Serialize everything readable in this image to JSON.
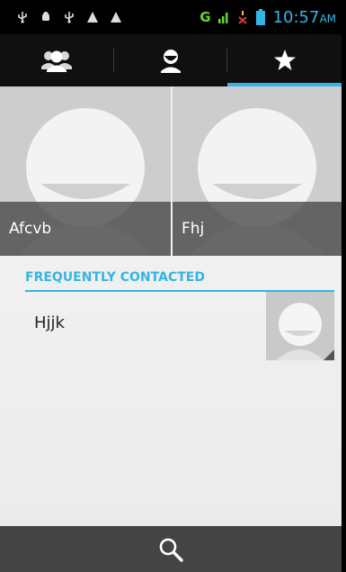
{
  "status_bar": {
    "network": "G",
    "time": "10:57",
    "ampm": "AM"
  },
  "tabs": [
    {
      "icon": "groups-icon",
      "selected": false
    },
    {
      "icon": "contact-icon",
      "selected": false
    },
    {
      "icon": "star-icon",
      "selected": true
    }
  ],
  "favorites": [
    {
      "name": "Afcvb"
    },
    {
      "name": "Fhj"
    }
  ],
  "frequently_contacted": {
    "header": "FREQUENTLY CONTACTED",
    "items": [
      {
        "name": "Hjjk"
      }
    ]
  },
  "action_bar": {
    "icon": "search-icon"
  },
  "colors": {
    "accent": "#33b5e5",
    "signal": "#6bd12f",
    "action_bar": "#444444"
  }
}
